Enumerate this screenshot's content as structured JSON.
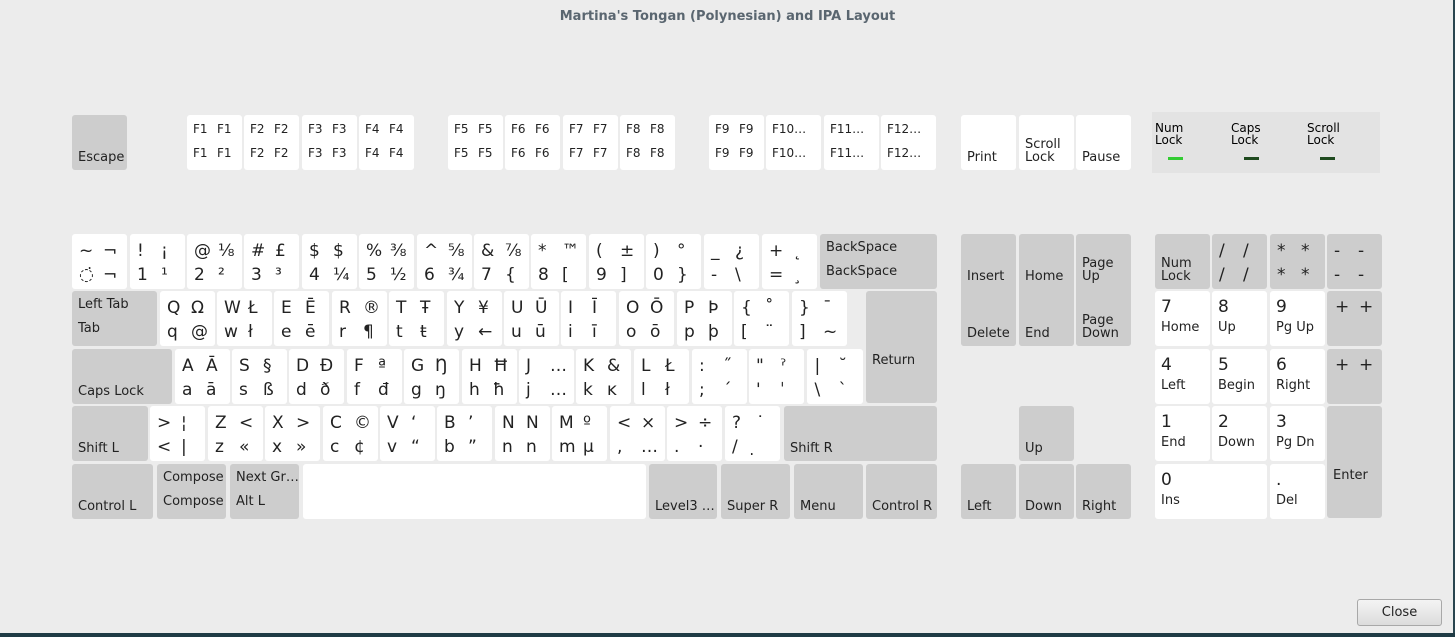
{
  "window": {
    "title": "Martina's Tongan (Polynesian) and IPA Layout"
  },
  "buttons": {
    "close_label": "Close"
  },
  "indicators": [
    {
      "label": "Num\nLock",
      "on": true
    },
    {
      "label": "Caps\nLock",
      "on": false
    },
    {
      "label": "Scroll\nLock",
      "on": false
    }
  ],
  "colors": {
    "led_on": "#33cc33",
    "led_off": "#1f4a1f",
    "key_gray": "#cdcdcd",
    "key_white": "#ffffff",
    "background": "#ececec"
  },
  "keys": {
    "esc": {
      "label": "Escape"
    },
    "f1": {
      "c": [
        "F1",
        "F1",
        "F1",
        "F1"
      ]
    },
    "f2": {
      "c": [
        "F2",
        "F2",
        "F2",
        "F2"
      ]
    },
    "f3": {
      "c": [
        "F3",
        "F3",
        "F3",
        "F3"
      ]
    },
    "f4": {
      "c": [
        "F4",
        "F4",
        "F4",
        "F4"
      ]
    },
    "f5": {
      "c": [
        "F5",
        "F5",
        "F5",
        "F5"
      ]
    },
    "f6": {
      "c": [
        "F6",
        "F6",
        "F6",
        "F6"
      ]
    },
    "f7": {
      "c": [
        "F7",
        "F7",
        "F7",
        "F7"
      ]
    },
    "f8": {
      "c": [
        "F8",
        "F8",
        "F8",
        "F8"
      ]
    },
    "f9": {
      "c": [
        "F9",
        "F9",
        "F9",
        "F9"
      ]
    },
    "f10": {
      "top": "F10…",
      "bot": "F10…"
    },
    "f11": {
      "top": "F11…",
      "bot": "F11…"
    },
    "f12": {
      "top": "F12…",
      "bot": "F12…"
    },
    "print": {
      "label": "Print"
    },
    "scrolllock": {
      "label": "Scroll\nLock"
    },
    "pause": {
      "label": "Pause"
    },
    "tlde": {
      "c": [
        "~",
        "¬",
        "◌̇",
        "¬"
      ]
    },
    "ae01": {
      "c": [
        "!",
        "¡",
        "1",
        "¹"
      ]
    },
    "ae02": {
      "c": [
        "@",
        "⅛",
        "2",
        "²"
      ]
    },
    "ae03": {
      "c": [
        "#",
        "£",
        "3",
        "³"
      ]
    },
    "ae04": {
      "c": [
        "$",
        "$",
        "4",
        "¼"
      ]
    },
    "ae05": {
      "c": [
        "%",
        "⅜",
        "5",
        "½"
      ]
    },
    "ae06": {
      "c": [
        "^",
        "⅝",
        "6",
        "¾"
      ]
    },
    "ae07": {
      "c": [
        "&",
        "⅞",
        "7",
        "{"
      ]
    },
    "ae08": {
      "c": [
        "*",
        "™",
        "8",
        "["
      ]
    },
    "ae09": {
      "c": [
        "(",
        "±",
        "9",
        "]"
      ]
    },
    "ae10": {
      "c": [
        ")",
        "°",
        "0",
        "}"
      ]
    },
    "ae11": {
      "c": [
        "_",
        "¿",
        "-",
        "\\"
      ]
    },
    "ae12": {
      "c": [
        "+",
        "˛",
        "=",
        "¸"
      ]
    },
    "bksp": {
      "top": "BackSpace",
      "bot": "BackSpace"
    },
    "tab": {
      "top": "Left Tab",
      "bot": "Tab"
    },
    "ad01": {
      "c": [
        "Q",
        "Ω",
        "q",
        "@"
      ]
    },
    "ad02": {
      "c": [
        "W",
        "Ł",
        "w",
        "ł"
      ]
    },
    "ad03": {
      "c": [
        "E",
        "Ē",
        "e",
        "ē"
      ]
    },
    "ad04": {
      "c": [
        "R",
        "®",
        "r",
        "¶"
      ]
    },
    "ad05": {
      "c": [
        "T",
        "Ŧ",
        "t",
        "ŧ"
      ]
    },
    "ad06": {
      "c": [
        "Y",
        "¥",
        "y",
        "←"
      ]
    },
    "ad07": {
      "c": [
        "U",
        "Ū",
        "u",
        "ū"
      ]
    },
    "ad08": {
      "c": [
        "I",
        "Ī",
        "i",
        "ī"
      ]
    },
    "ad09": {
      "c": [
        "O",
        "Ō",
        "o",
        "ō"
      ]
    },
    "ad10": {
      "c": [
        "P",
        "Þ",
        "p",
        "þ"
      ]
    },
    "ad11": {
      "c": [
        "{",
        "˚",
        "[",
        "¨"
      ]
    },
    "ad12": {
      "c": [
        "}",
        "¯",
        "]",
        "~"
      ]
    },
    "ret": {
      "label": "Return"
    },
    "caps": {
      "label": "Caps Lock"
    },
    "ac01": {
      "c": [
        "A",
        "Ā",
        "a",
        "ā"
      ]
    },
    "ac02": {
      "c": [
        "S",
        "§",
        "s",
        "ß"
      ]
    },
    "ac03": {
      "c": [
        "D",
        "Đ",
        "d",
        "ð"
      ]
    },
    "ac04": {
      "c": [
        "F",
        "ª",
        "f",
        "đ"
      ]
    },
    "ac05": {
      "c": [
        "G",
        "Ŋ",
        "g",
        "ŋ"
      ]
    },
    "ac06": {
      "c": [
        "H",
        "Ħ",
        "h",
        "ħ"
      ]
    },
    "ac07": {
      "c": [
        "J",
        "…",
        "j",
        "…"
      ]
    },
    "ac08": {
      "c": [
        "K",
        "&",
        "k",
        "ĸ"
      ]
    },
    "ac09": {
      "c": [
        "L",
        "Ł",
        "l",
        "ł"
      ]
    },
    "ac10": {
      "c": [
        ":",
        "˝",
        ";",
        "´"
      ]
    },
    "ac11": {
      "c": [
        "\"",
        "ˀ",
        "'",
        "ˈ"
      ]
    },
    "bksl": {
      "c": [
        "|",
        "˘",
        "\\",
        "`"
      ]
    },
    "lfsh": {
      "label": "Shift L"
    },
    "lsgt": {
      "c": [
        ">",
        "¦",
        "<",
        "|"
      ]
    },
    "ab01": {
      "c": [
        "Z",
        "<",
        "z",
        "«"
      ]
    },
    "ab02": {
      "c": [
        "X",
        ">",
        "x",
        "»"
      ]
    },
    "ab03": {
      "c": [
        "C",
        "©",
        "c",
        "¢"
      ]
    },
    "ab04": {
      "c": [
        "V",
        "‘",
        "v",
        "“"
      ]
    },
    "ab05": {
      "c": [
        "B",
        "’",
        "b",
        "”"
      ]
    },
    "ab06": {
      "c": [
        "N",
        "N",
        "n",
        "n"
      ]
    },
    "ab07": {
      "c": [
        "M",
        "º",
        "m",
        "µ"
      ]
    },
    "ab08": {
      "c": [
        "<",
        "×",
        ",",
        "…"
      ]
    },
    "ab09": {
      "c": [
        ">",
        "÷",
        ".",
        "·"
      ]
    },
    "ab10": {
      "c": [
        "?",
        "˙",
        "/",
        "̣"
      ]
    },
    "rtsh": {
      "label": "Shift R"
    },
    "lctl": {
      "label": "Control L"
    },
    "comp": {
      "top": "Compose",
      "bot": "Compose"
    },
    "lalt": {
      "top": "Next Gr…",
      "bot": "Alt L"
    },
    "lvl3": {
      "label": "Level3 …"
    },
    "rwin": {
      "label": "Super R"
    },
    "menu": {
      "label": "Menu"
    },
    "rctl": {
      "label": "Control R"
    },
    "ins": {
      "label": "Insert"
    },
    "home": {
      "label": "Home"
    },
    "pgup": {
      "label": "Page\nUp"
    },
    "dele": {
      "label": "Delete"
    },
    "end": {
      "label": "End"
    },
    "pgdn": {
      "label": "Page\nDown"
    },
    "up": {
      "label": "Up"
    },
    "left": {
      "label": "Left"
    },
    "down": {
      "label": "Down"
    },
    "right": {
      "label": "Right"
    },
    "nmlk": {
      "label": "Num\nLock"
    },
    "kpdv": {
      "c": [
        "/",
        "/",
        "/",
        "/"
      ]
    },
    "kpmu": {
      "c": [
        "*",
        "*",
        "*",
        "*"
      ]
    },
    "kpsu": {
      "c": [
        "-",
        "-",
        "-",
        "-"
      ]
    },
    "kp7": {
      "top": "7",
      "bot": "Home"
    },
    "kp8": {
      "top": "8",
      "bot": "Up"
    },
    "kp9": {
      "top": "9",
      "bot": "Pg Up"
    },
    "kpad": {
      "c": [
        "+",
        "+"
      ]
    },
    "kp4": {
      "top": "4",
      "bot": "Left"
    },
    "kp5": {
      "top": "5",
      "bot": "Begin"
    },
    "kp6": {
      "top": "6",
      "bot": "Right"
    },
    "kpadd2": {
      "c": [
        "+",
        "+"
      ]
    },
    "kp1": {
      "top": "1",
      "bot": "End"
    },
    "kp2": {
      "top": "2",
      "bot": "Down"
    },
    "kp3": {
      "top": "3",
      "bot": "Pg Dn"
    },
    "kpen": {
      "label": "Enter"
    },
    "kp0": {
      "top": "0",
      "bot": "Ins"
    },
    "kpdl": {
      "top": ".",
      "bot": "Del"
    }
  }
}
